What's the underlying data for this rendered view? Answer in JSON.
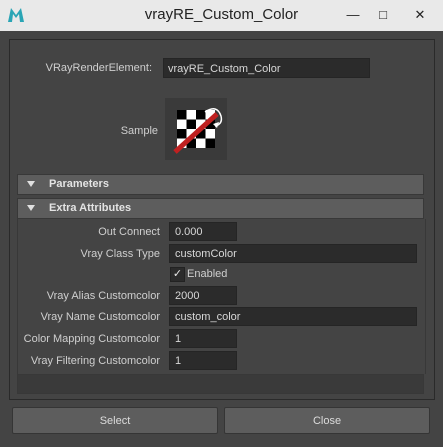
{
  "window": {
    "title": "vrayRE_Custom_Color",
    "min_icon": "minimize-icon",
    "max_icon": "maximize-icon",
    "close_icon": "close-icon",
    "app_icon": "maya-icon"
  },
  "header": {
    "element_label": "VRayRenderElement:",
    "element_value": "vrayRE_Custom_Color",
    "sample_label": "Sample"
  },
  "sections": {
    "parameters": "Parameters",
    "extra_attributes": "Extra Attributes"
  },
  "attributes": {
    "out_connect_label": "Out Connect",
    "out_connect_value": "0.000",
    "class_type_label": "Vray Class Type",
    "class_type_value": "customColor",
    "enabled_label": "Enabled",
    "enabled_checked": true,
    "alias_label": "Vray Alias Customcolor",
    "alias_value": "2000",
    "name_label": "Vray Name Customcolor",
    "name_value": "custom_color",
    "color_mapping_label": "' Color Mapping Customcolor",
    "color_mapping_value": "1",
    "filtering_label": "Vray Filtering Customcolor",
    "filtering_value": "1"
  },
  "buttons": {
    "select": "Select",
    "close": "Close"
  },
  "colors": {
    "background": "#444444",
    "titlebar": "#e9e9e9",
    "field": "#2b2b2b",
    "accent_red": "#c02020"
  }
}
